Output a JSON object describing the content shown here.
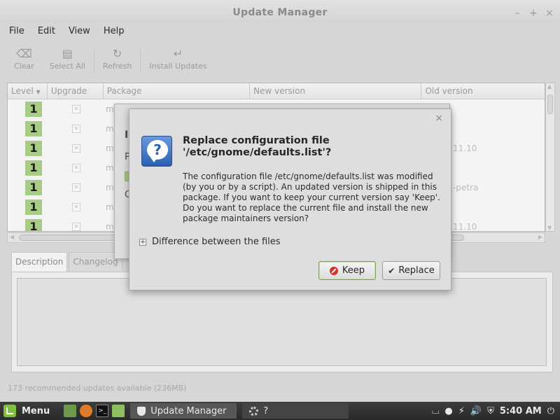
{
  "window": {
    "title": "Update Manager",
    "controls": {
      "minimize": "–",
      "maximize": "+",
      "close": "×"
    }
  },
  "menubar": {
    "items": [
      "File",
      "Edit",
      "View",
      "Help"
    ]
  },
  "toolbar": {
    "items": [
      {
        "label": "Clear",
        "icon": "⌫"
      },
      {
        "label": "Select All",
        "icon": "▤"
      },
      {
        "label": "Refresh",
        "icon": "↻"
      },
      {
        "label": "Install Updates",
        "icon": "↵"
      }
    ]
  },
  "update_list": {
    "columns": [
      "Level",
      "Upgrade",
      "Package",
      "New version",
      "Old version"
    ],
    "sort_indicator": "▼",
    "rows": [
      {
        "level": "1",
        "package": "m",
        "old_version": ""
      },
      {
        "level": "1",
        "package": "m",
        "old_version": ""
      },
      {
        "level": "1",
        "package": "m",
        "old_version": "11.10"
      },
      {
        "level": "1",
        "package": "m",
        "old_version": ""
      },
      {
        "level": "1",
        "package": "m",
        "old_version": "-petra"
      },
      {
        "level": "1",
        "package": "m",
        "old_version": ""
      },
      {
        "level": "1",
        "package": "m",
        "old_version": "11.10"
      }
    ],
    "check_glyph": "✕"
  },
  "tabs": [
    "Description",
    "Changelog"
  ],
  "status": "173 recommended updates available (236MB)",
  "bg_dialog": {
    "fragment_1": "In",
    "fragment_2": "P",
    "fragment_3": "C"
  },
  "dialog": {
    "close": "×",
    "icon_glyph": "?",
    "heading": "Replace configuration file '/etc/gnome/defaults.list'?",
    "body": "The configuration file /etc/gnome/defaults.list was modified (by you or by a script). An updated version is shipped in this package. If you want to keep your current version say 'Keep'. Do you want to replace the current file and install the new package maintainers version?",
    "expander_sign": "+",
    "expander_label": "Difference between the files",
    "keep_label": "Keep",
    "replace_label": "Replace",
    "replace_icon": "✔"
  },
  "taskbar": {
    "menu_label": "Menu",
    "terminal_glyph": ">_",
    "windows": [
      "Update Manager",
      "?"
    ],
    "clock": "5:40 AM"
  },
  "colors": {
    "level_badge": "#a8cc86",
    "keep_border": "#78a050",
    "dialog_icon": "#2b5fb3",
    "taskbar": "#333333"
  }
}
